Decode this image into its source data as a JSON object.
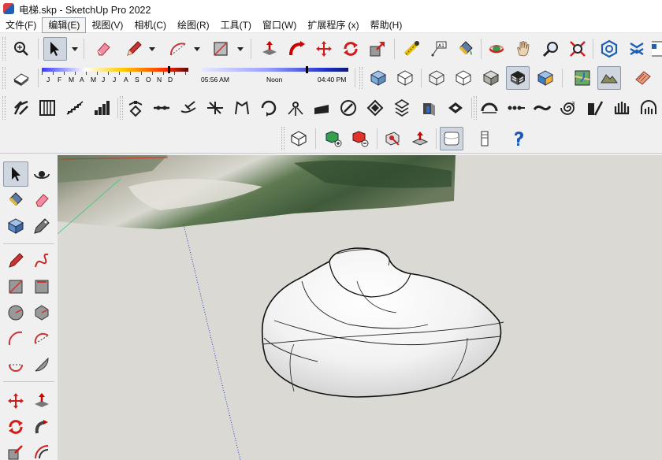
{
  "title_bar": {
    "title": "电梯.skp - SketchUp Pro 2022"
  },
  "menu_bar": {
    "items": [
      {
        "label": "文件(F)",
        "active": false
      },
      {
        "label": "编辑(E)",
        "active": true
      },
      {
        "label": "视图(V)",
        "active": false
      },
      {
        "label": "相机(C)",
        "active": false
      },
      {
        "label": "绘图(R)",
        "active": false
      },
      {
        "label": "工具(T)",
        "active": false
      },
      {
        "label": "窗口(W)",
        "active": false
      },
      {
        "label": "扩展程序 (x)",
        "active": false
      },
      {
        "label": "帮助(H)",
        "active": false
      }
    ]
  },
  "shadows": {
    "months": [
      "J",
      "F",
      "M",
      "A",
      "M",
      "J",
      "J",
      "A",
      "S",
      "O",
      "N",
      "D"
    ],
    "month_position": 0.86,
    "time_start": "05:56 AM",
    "time_mid": "Noon",
    "time_end": "04:40 PM",
    "time_position": 0.71
  },
  "toolbar_row1": [
    "zoom-extents-icon",
    "select-arrow-icon",
    "eraser-icon",
    "pencil-line-icon",
    "arc-icon",
    "rectangle-icon",
    "push-pull-icon",
    "follow-me-icon",
    "move-icon",
    "rotate-icon",
    "scale-icon",
    "tape-measure-icon",
    "text-label-icon",
    "paint-bucket-icon",
    "orbit-icon",
    "pan-hand-icon",
    "zoom-icon",
    "zoom-window-icon",
    "warehouse-icon",
    "extension-warehouse-icon",
    "layout-icon"
  ],
  "toolbar_row2_right": [
    "xray-icon",
    "back-edges-icon",
    "wireframe-icon",
    "hidden-line-icon",
    "shaded-icon",
    "textures-icon",
    "monochrome-icon",
    "map-icon",
    "terrain-icon",
    "building-icon"
  ],
  "toolbar_row4": [
    "iso-view-icon",
    "add-component-icon",
    "remove-component-icon",
    "push-hole-icon",
    "extrude-icon",
    "smooth-icon",
    "column-icon",
    "help-icon"
  ],
  "left_toolbar": [
    "select-icon",
    "orbit-left-icon",
    "paint-left-icon",
    "eraser-left-icon",
    "component-icon",
    "tag-icon",
    "line-left-icon",
    "freehand-icon",
    "rect-left-icon",
    "rotated-rect-icon",
    "circle-icon",
    "polygon-icon",
    "arc-left-icon",
    "arc2-icon",
    "arc3-icon",
    "pie-icon",
    "move-left-icon",
    "pushpull-left-icon",
    "rotate-left-icon",
    "followme-left-icon",
    "scale-left-icon",
    "offset-left-icon"
  ]
}
